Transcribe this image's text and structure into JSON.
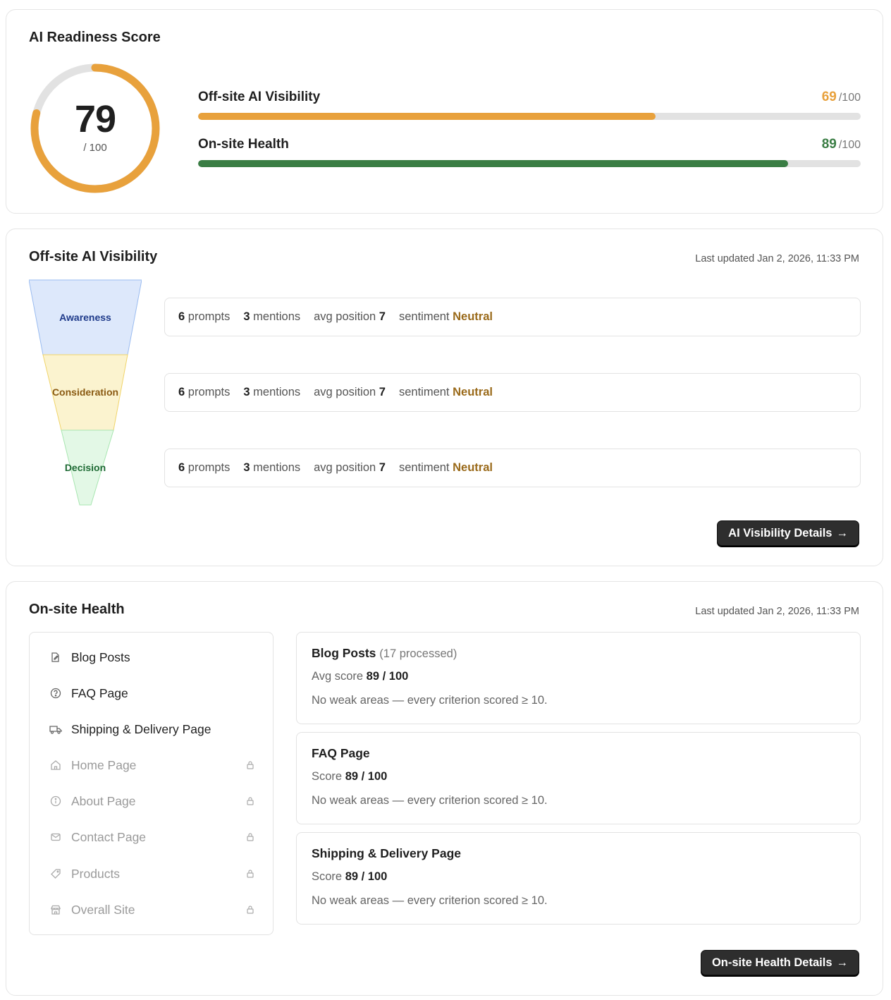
{
  "readiness": {
    "title": "AI Readiness Score",
    "score": "79",
    "score_max": "/ 100",
    "score_fraction": 0.79,
    "metrics": [
      {
        "label": "Off-site AI Visibility",
        "value": "69",
        "max": "/100",
        "fraction": 0.69,
        "color": "#e8a13c"
      },
      {
        "label": "On-site Health",
        "value": "89",
        "max": "/100",
        "fraction": 0.89,
        "color": "#3a7d44"
      }
    ]
  },
  "offsite": {
    "title": "Off-site AI Visibility",
    "updated": "Last updated Jan 2, 2026, 11:33 PM",
    "stages": [
      {
        "name": "Awareness",
        "prompts": "6",
        "prompts_label": "prompts",
        "mentions": "3",
        "mentions_label": "mentions",
        "position_label": "avg position",
        "position": "7",
        "sentiment_label": "sentiment",
        "sentiment": "Neutral"
      },
      {
        "name": "Consideration",
        "prompts": "6",
        "prompts_label": "prompts",
        "mentions": "3",
        "mentions_label": "mentions",
        "position_label": "avg position",
        "position": "7",
        "sentiment_label": "sentiment",
        "sentiment": "Neutral"
      },
      {
        "name": "Decision",
        "prompts": "6",
        "prompts_label": "prompts",
        "mentions": "3",
        "mentions_label": "mentions",
        "position_label": "avg position",
        "position": "7",
        "sentiment_label": "sentiment",
        "sentiment": "Neutral"
      }
    ],
    "button": "AI Visibility Details",
    "button_arrow": "→"
  },
  "onsite": {
    "title": "On-site Health",
    "updated": "Last updated Jan 2, 2026, 11:33 PM",
    "nav": [
      {
        "label": "Blog Posts",
        "icon": "edit-document-icon",
        "locked": false
      },
      {
        "label": "FAQ Page",
        "icon": "question-circle-icon",
        "locked": false
      },
      {
        "label": "Shipping & Delivery Page",
        "icon": "truck-icon",
        "locked": false
      },
      {
        "label": "Home Page",
        "icon": "home-icon",
        "locked": true
      },
      {
        "label": "About Page",
        "icon": "info-circle-icon",
        "locked": true
      },
      {
        "label": "Contact Page",
        "icon": "mail-icon",
        "locked": true
      },
      {
        "label": "Products",
        "icon": "tag-icon",
        "locked": true
      },
      {
        "label": "Overall Site",
        "icon": "store-icon",
        "locked": true
      }
    ],
    "details": [
      {
        "title": "Blog Posts",
        "processed": "(17 processed)",
        "score_label": "Avg score",
        "score": "89 / 100",
        "note": "No weak areas — every criterion scored ≥ 10."
      },
      {
        "title": "FAQ Page",
        "processed": "",
        "score_label": "Score",
        "score": "89 / 100",
        "note": "No weak areas — every criterion scored ≥ 10."
      },
      {
        "title": "Shipping & Delivery Page",
        "processed": "",
        "score_label": "Score",
        "score": "89 / 100",
        "note": "No weak areas — every criterion scored ≥ 10."
      }
    ],
    "button": "On-site Health Details",
    "button_arrow": "→"
  },
  "colors": {
    "orange": "#e8a13c",
    "green": "#3a7d44",
    "track": "#e2e2e2",
    "sentiment": "#9a6a1a",
    "awareness": "#dde8fb",
    "consideration": "#fbf3cf",
    "decision": "#e3f8e6"
  }
}
